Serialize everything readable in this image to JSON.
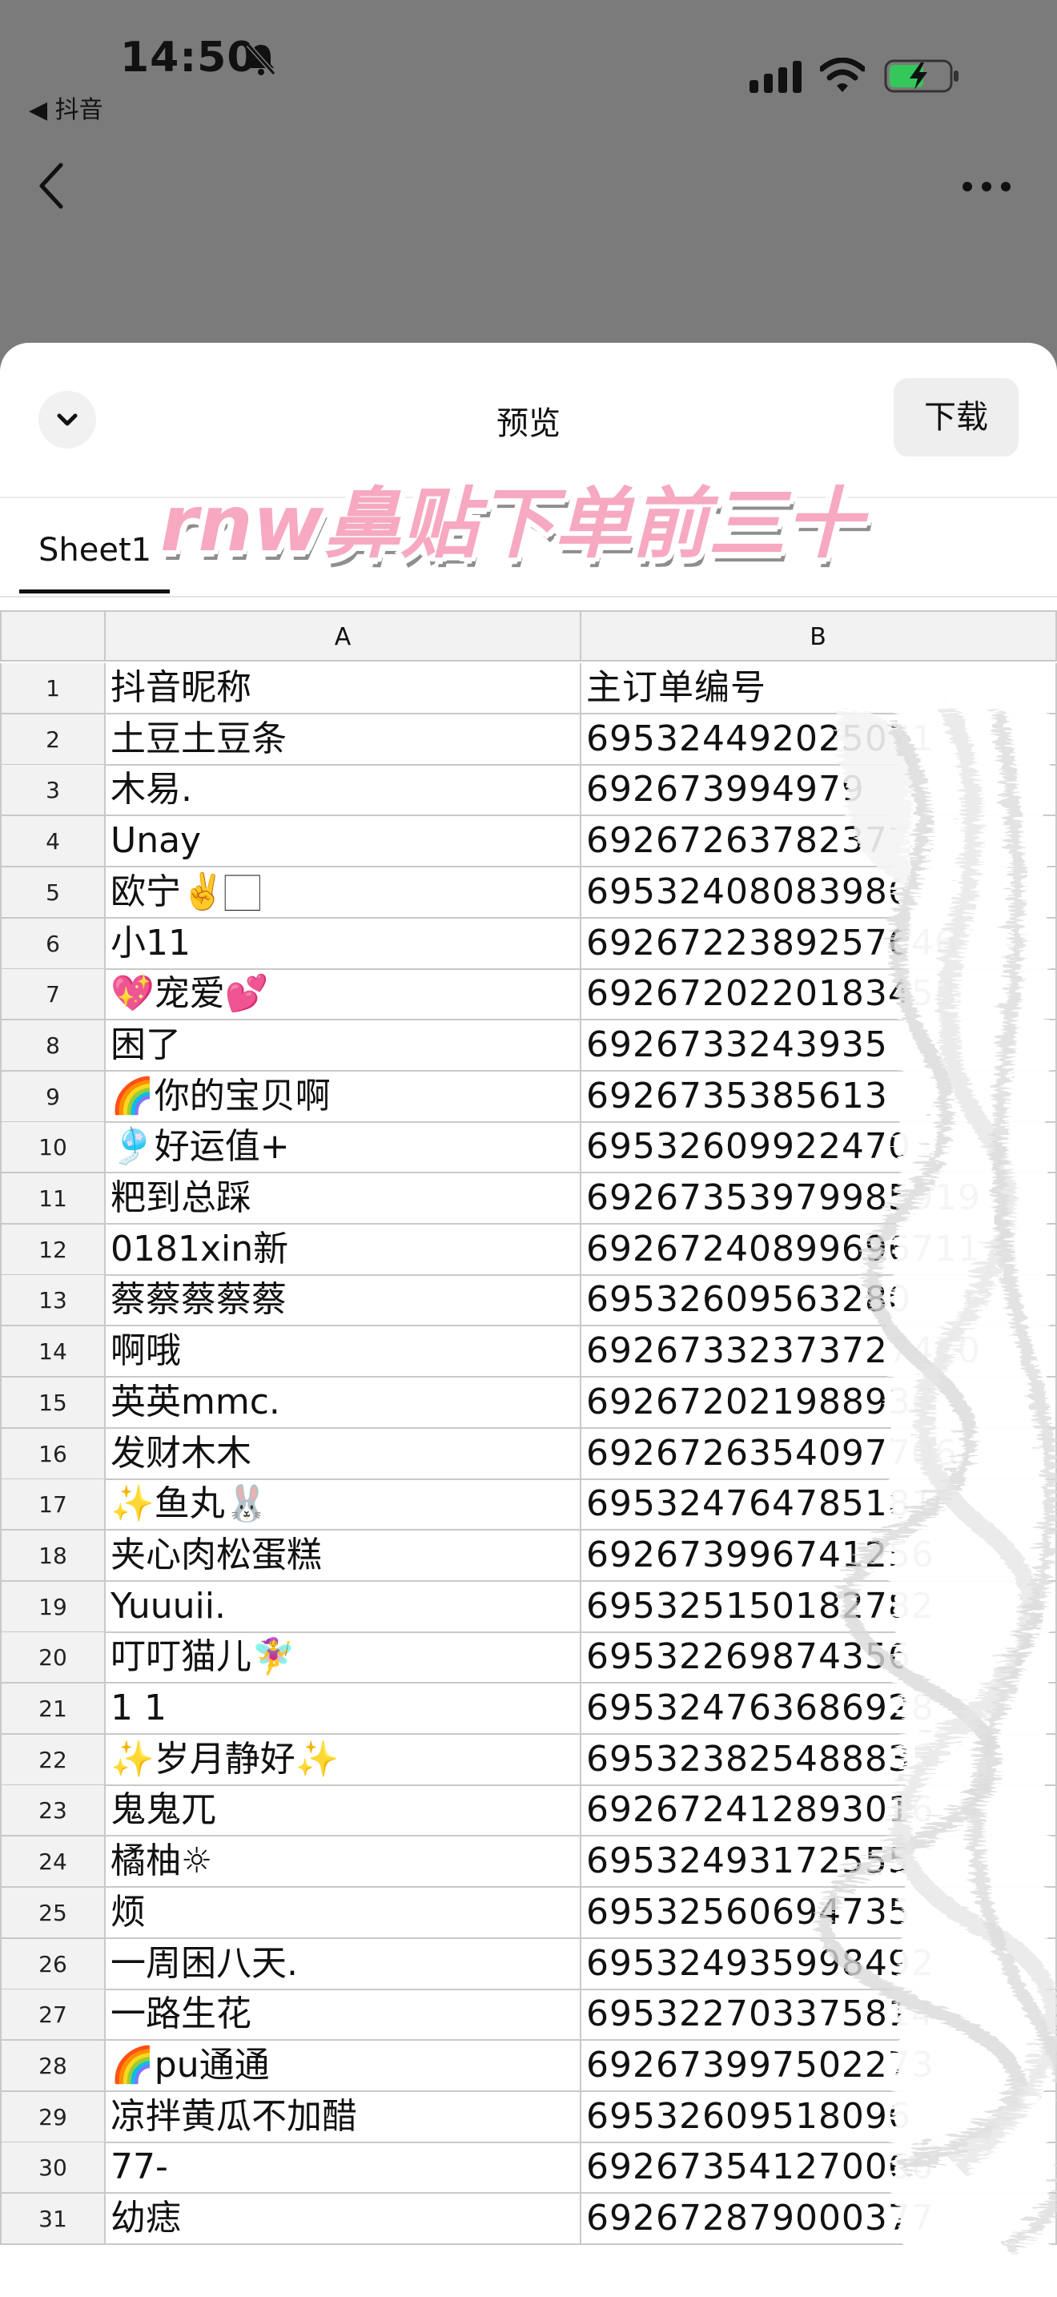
{
  "status_bar": {
    "time": "14:50",
    "back_app": "◀ 抖音"
  },
  "sheet": {
    "title": "预览",
    "download_label": "下载",
    "sticker_text": "rnw鼻贴下单前三十",
    "tab_label": "Sheet1",
    "column_headers": [
      "A",
      "B"
    ],
    "rows": [
      {
        "n": "1",
        "a": "抖音昵称",
        "b": "主订单编号"
      },
      {
        "n": "2",
        "a": "土豆土豆条",
        "b": "695324492025071"
      },
      {
        "n": "3",
        "a": "木易.",
        "b": "692673994979"
      },
      {
        "n": "4",
        "a": "Unay",
        "b": "69267263782377"
      },
      {
        "n": "5",
        "a": "欧宁✌️🏻",
        "b": "69532408083986"
      },
      {
        "n": "6",
        "a": "小11",
        "b": "6926722389257646"
      },
      {
        "n": "7",
        "a": "💖宠爱💕",
        "b": "6926720220183458"
      },
      {
        "n": "8",
        "a": "困了",
        "b": "6926733243935"
      },
      {
        "n": "9",
        "a": "🌈你的宝贝啊",
        "b": "6926735385613"
      },
      {
        "n": "10",
        "a": "🎐好运值+",
        "b": "69532609922470"
      },
      {
        "n": "11",
        "a": "粑到总踩",
        "b": "69267353979985919"
      },
      {
        "n": "12",
        "a": "0181xin新",
        "b": "69267240899696711"
      },
      {
        "n": "13",
        "a": "蔡蔡蔡蔡蔡",
        "b": "69532609563280"
      },
      {
        "n": "14",
        "a": "啊哦",
        "b": "69267332373727470"
      },
      {
        "n": "15",
        "a": "英英mmc.",
        "b": "692672021988936"
      },
      {
        "n": "16",
        "a": "发财木木",
        "b": "6926726354097706"
      },
      {
        "n": "17",
        "a": "✨鱼丸🐰",
        "b": "695324764785181"
      },
      {
        "n": "18",
        "a": "夹心肉松蛋糕",
        "b": "692673996741256"
      },
      {
        "n": "19",
        "a": "Yuuuii.",
        "b": "695325150182782"
      },
      {
        "n": "20",
        "a": "叮叮猫儿🧚‍♀️",
        "b": "69532269874356"
      },
      {
        "n": "21",
        "a": "1 1",
        "b": "695324763686928"
      },
      {
        "n": "22",
        "a": "✨岁月静好✨",
        "b": "695323825488835"
      },
      {
        "n": "23",
        "a": "鬼鬼兀",
        "b": "692672412893016"
      },
      {
        "n": "24",
        "a": "橘柚☼",
        "b": "69532493172555"
      },
      {
        "n": "25",
        "a": "烦",
        "b": "69532560694735"
      },
      {
        "n": "26",
        "a": "一周困八天.",
        "b": "695324935998492"
      },
      {
        "n": "27",
        "a": "一路生花",
        "b": "695322703375814"
      },
      {
        "n": "28",
        "a": "🌈pu通通",
        "b": "692673997502273"
      },
      {
        "n": "29",
        "a": "凉拌黄瓜不加醋",
        "b": "69532609518096"
      },
      {
        "n": "30",
        "a": "77-",
        "b": "692673541270060"
      },
      {
        "n": "31",
        "a": "幼痣",
        "b": "692672879000377"
      }
    ]
  },
  "icons": [
    "bell-off-icon",
    "signal-icon",
    "wifi-icon",
    "battery-charging-icon",
    "back-chevron-icon",
    "more-icon",
    "chevron-down-icon"
  ]
}
